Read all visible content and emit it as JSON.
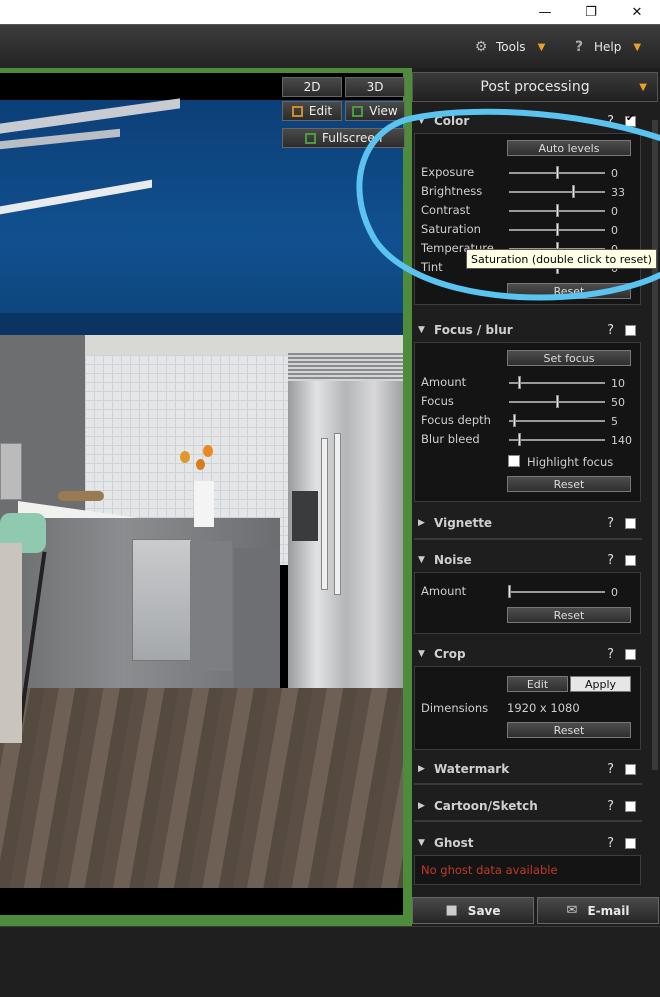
{
  "window": {
    "minimize": "—",
    "maximize": "❐",
    "close": "✕"
  },
  "menubar": {
    "tools_label": "Tools",
    "help_label": "Help",
    "tools_icon": "gears-icon",
    "help_icon": "question-icon"
  },
  "view_buttons": {
    "b2d": "2D",
    "b3d": "3D",
    "edit": "Edit",
    "view": "View",
    "fullscreen": "Fullscreen"
  },
  "panel": {
    "title": "Post processing",
    "color": {
      "title": "Color",
      "auto_levels": "Auto levels",
      "sliders": [
        {
          "label": "Exposure",
          "value": "0",
          "pos": 0.5
        },
        {
          "label": "Brightness",
          "value": "33",
          "pos": 0.67
        },
        {
          "label": "Contrast",
          "value": "0",
          "pos": 0.5
        },
        {
          "label": "Saturation",
          "value": "0",
          "pos": 0.5
        },
        {
          "label": "Temperature",
          "value": "0",
          "pos": 0.5
        },
        {
          "label": "Tint",
          "value": "0",
          "pos": 0.5
        }
      ],
      "reset": "Reset",
      "enabled": true
    },
    "focus": {
      "title": "Focus / blur",
      "set_focus": "Set focus",
      "sliders": [
        {
          "label": "Amount",
          "value": "10",
          "pos": 0.1
        },
        {
          "label": "Focus",
          "value": "50",
          "pos": 0.5
        },
        {
          "label": "Focus depth",
          "value": "5",
          "pos": 0.05
        },
        {
          "label": "Blur bleed",
          "value": "140",
          "pos": 0.1
        }
      ],
      "highlight_focus": "Highlight focus",
      "reset": "Reset"
    },
    "vignette": {
      "title": "Vignette"
    },
    "noise": {
      "title": "Noise",
      "sliders": [
        {
          "label": "Amount",
          "value": "0",
          "pos": 0.0
        }
      ],
      "reset": "Reset"
    },
    "crop": {
      "title": "Crop",
      "edit": "Edit",
      "apply": "Apply",
      "dimensions_label": "Dimensions",
      "dimensions_value": "1920 x 1080",
      "reset": "Reset"
    },
    "watermark": {
      "title": "Watermark"
    },
    "cartoon": {
      "title": "Cartoon/Sketch"
    },
    "ghost": {
      "title": "Ghost",
      "message": "No ghost data available"
    },
    "help_glyph": "?"
  },
  "bottom": {
    "save": "Save",
    "email": "E-mail"
  },
  "tooltip": "Saturation (double click to reset)",
  "colors": {
    "accent": "#f0a020",
    "frame": "#4e8c3c",
    "annotation": "#5bc3f0",
    "ghost_text": "#c0392b"
  }
}
